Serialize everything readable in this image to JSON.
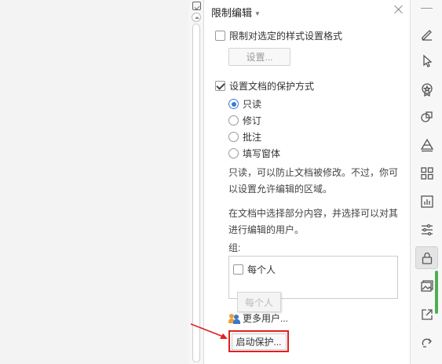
{
  "panel": {
    "title": "限制编辑",
    "restrict_format_label": "限制对选定的样式设置格式",
    "settings_button": "设置...",
    "protect_mode_label": "设置文档的保护方式",
    "radio_options": [
      "只读",
      "修订",
      "批注",
      "填写窗体"
    ],
    "selected_option": "只读",
    "desc1_line1": "只读，可以防止文档被修改。不过，你可",
    "desc1_line2": "以设置允许编辑的区域。",
    "desc2_line1": "在文档中选择部分内容，并选择可以对其",
    "desc2_line2": "进行编辑的用户。",
    "group_label": "组:",
    "group_everyone": "每个人",
    "tooltip_text": "每个人",
    "more_users": "更多用户...",
    "start_protection": "启动保护..."
  },
  "toolbar": {
    "icons": [
      "pen-icon",
      "pointer-icon",
      "stamp-icon",
      "shapes-icon",
      "layers-icon",
      "apps-icon",
      "chart-icon",
      "sliders-icon",
      "lock-icon",
      "image-icon",
      "share-icon",
      "redo-icon"
    ],
    "active": "lock-icon"
  },
  "colors": {
    "highlight_red": "#e02020",
    "radio_blue": "#3a7bd5",
    "scroll_green": "#4caf50"
  }
}
